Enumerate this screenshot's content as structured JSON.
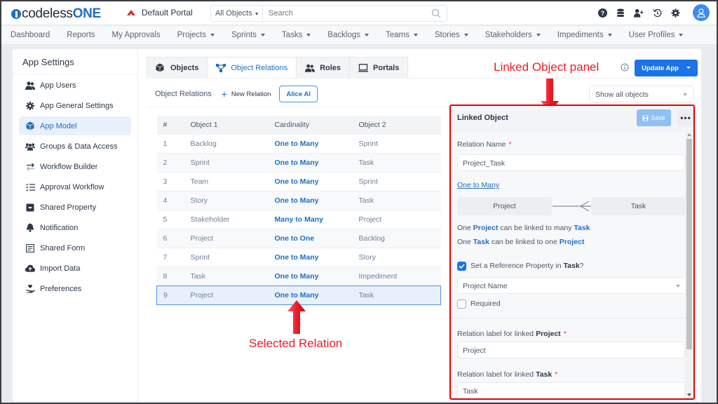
{
  "header": {
    "logo_prefix": "codeless",
    "logo_suffix": "ONE",
    "portal_name": "Default Portal",
    "search_scope": "All Objects",
    "search_placeholder": "Search",
    "icons": [
      "help-icon",
      "database-icon",
      "add-user-icon",
      "history-icon",
      "settings-icon",
      "user-avatar-icon"
    ]
  },
  "nav": {
    "items": [
      {
        "label": "Dashboard",
        "dropdown": false
      },
      {
        "label": "Reports",
        "dropdown": false
      },
      {
        "label": "My Approvals",
        "dropdown": false
      },
      {
        "label": "Projects",
        "dropdown": true
      },
      {
        "label": "Sprints",
        "dropdown": true
      },
      {
        "label": "Tasks",
        "dropdown": true
      },
      {
        "label": "Backlogs",
        "dropdown": true
      },
      {
        "label": "Teams",
        "dropdown": true
      },
      {
        "label": "Stories",
        "dropdown": true
      },
      {
        "label": "Stakeholders",
        "dropdown": true
      },
      {
        "label": "Impediments",
        "dropdown": true
      },
      {
        "label": "User Profiles",
        "dropdown": true
      }
    ]
  },
  "sidebar": {
    "title": "App Settings",
    "items": [
      {
        "label": "App Users",
        "icon": "users-icon"
      },
      {
        "label": "App General Settings",
        "icon": "gear-icon"
      },
      {
        "label": "App Model",
        "icon": "cube-icon",
        "active": true
      },
      {
        "label": "Groups & Data Access",
        "icon": "groups-icon"
      },
      {
        "label": "Workflow Builder",
        "icon": "exchange-icon"
      },
      {
        "label": "Approval Workflow",
        "icon": "checklist-icon"
      },
      {
        "label": "Shared Property",
        "icon": "inbox-icon"
      },
      {
        "label": "Notification",
        "icon": "bell-icon"
      },
      {
        "label": "Shared Form",
        "icon": "form-icon"
      },
      {
        "label": "Import Data",
        "icon": "cloud-upload-icon"
      },
      {
        "label": "Preferences",
        "icon": "hand-heart-icon"
      }
    ]
  },
  "main": {
    "tabs": [
      {
        "label": "Objects",
        "icon": "cube-icon"
      },
      {
        "label": "Object Relations",
        "icon": "relations-icon",
        "active": true
      },
      {
        "label": "Roles",
        "icon": "users-icon"
      },
      {
        "label": "Portals",
        "icon": "monitor-icon"
      }
    ],
    "subbar": {
      "title": "Object Relations",
      "new_relation": "New Relation",
      "alice_ai": "Alice AI"
    },
    "update_app": "Update App",
    "filter_value": "Show all objects",
    "table": {
      "columns": [
        "#",
        "Object 1",
        "Cardinality",
        "Object 2"
      ],
      "rows": [
        {
          "num": "1",
          "object1": "Backlog",
          "cardinality": "One to Many",
          "object2": "Sprint"
        },
        {
          "num": "2",
          "object1": "Sprint",
          "cardinality": "One to Many",
          "object2": "Task"
        },
        {
          "num": "3",
          "object1": "Team",
          "cardinality": "One to Many",
          "object2": "Sprint"
        },
        {
          "num": "4",
          "object1": "Story",
          "cardinality": "One to Many",
          "object2": "Task"
        },
        {
          "num": "5",
          "object1": "Stakeholder",
          "cardinality": "Many to Many",
          "object2": "Project"
        },
        {
          "num": "6",
          "object1": "Project",
          "cardinality": "One to One",
          "object2": "Backlog"
        },
        {
          "num": "7",
          "object1": "Sprint",
          "cardinality": "One to Many",
          "object2": "Story"
        },
        {
          "num": "8",
          "object1": "Task",
          "cardinality": "One to Many",
          "object2": "Impediment"
        },
        {
          "num": "9",
          "object1": "Project",
          "cardinality": "One to Many",
          "object2": "Task",
          "selected": true
        }
      ]
    }
  },
  "annotations": {
    "panel_label": "Linked Object panel",
    "selected_label": "Selected Relation",
    "color": "#ee1c25"
  },
  "panel": {
    "title": "Linked Object",
    "save_label": "Save",
    "more_label": "•••",
    "relation_name_label": "Relation Name",
    "relation_name_value": "Project_Task",
    "cardinality": "One to Many",
    "object1": "Project",
    "object2": "Task",
    "sentence1": {
      "pre": "One ",
      "obj_a": "Project",
      "mid": " can be linked to many ",
      "obj_b": "Task"
    },
    "sentence2": {
      "pre": "One ",
      "obj_a": "Task",
      "mid": " can be linked to one ",
      "obj_b": "Project"
    },
    "reference_checkbox": {
      "pre": "Set a Reference Property in ",
      "obj": "Task",
      "post": "?",
      "checked": true
    },
    "reference_property": "Project Name",
    "required_label": "Required",
    "required_checked": false,
    "label_project": {
      "pre": "Relation label for linked ",
      "obj": "Project",
      "value": "Project"
    },
    "label_task": {
      "pre": "Relation label for linked ",
      "obj": "Task",
      "value": "Task"
    }
  },
  "colors": {
    "accent": "#1a73e8",
    "link": "#1f6fc5",
    "annotation": "#ee1c25"
  }
}
